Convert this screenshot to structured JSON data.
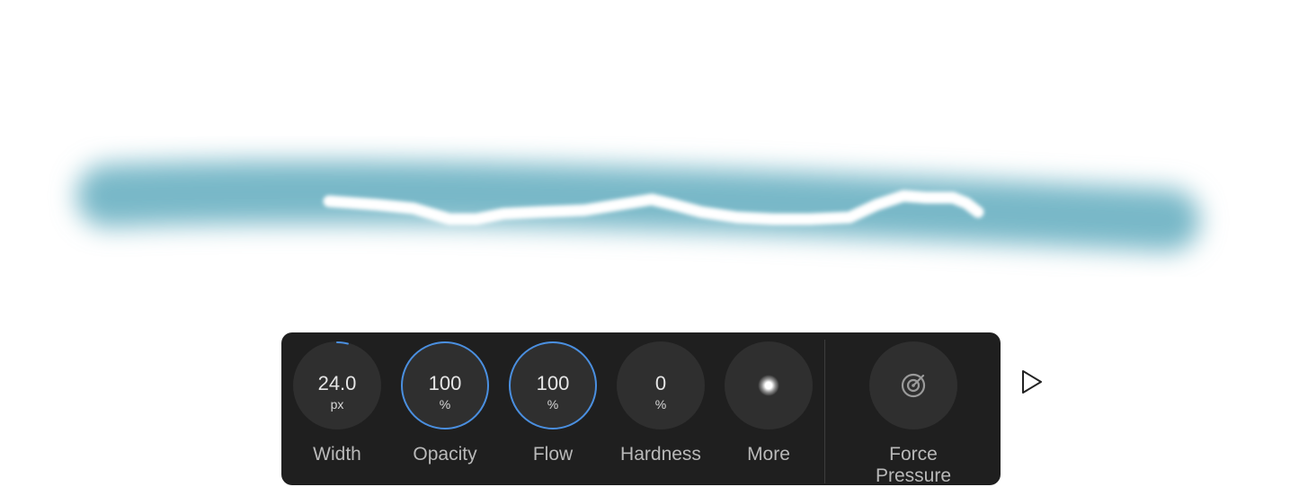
{
  "controls": [
    {
      "id": "width",
      "value": "24.0",
      "unit": "px",
      "label": "Width",
      "level": 0.04
    },
    {
      "id": "opacity",
      "value": "100",
      "unit": "%",
      "label": "Opacity",
      "level": 1.0
    },
    {
      "id": "flow",
      "value": "100",
      "unit": "%",
      "label": "Flow",
      "level": 1.0
    },
    {
      "id": "hardness",
      "value": "0",
      "unit": "%",
      "label": "Hardness",
      "level": 0.0
    }
  ],
  "more": {
    "label": "More",
    "icon": "brush-tip-preview-icon"
  },
  "force_pressure": {
    "label": "Force Pressure",
    "icon": "force-pressure-icon"
  },
  "play": {
    "icon": "play-triangle-icon"
  },
  "colors": {
    "stroke": "#78b8c8",
    "toolbar_bg": "#1f1f1f",
    "control_bg": "#2f2f2f",
    "accent": "#4a8fe0",
    "label": "#b9b9b9"
  }
}
